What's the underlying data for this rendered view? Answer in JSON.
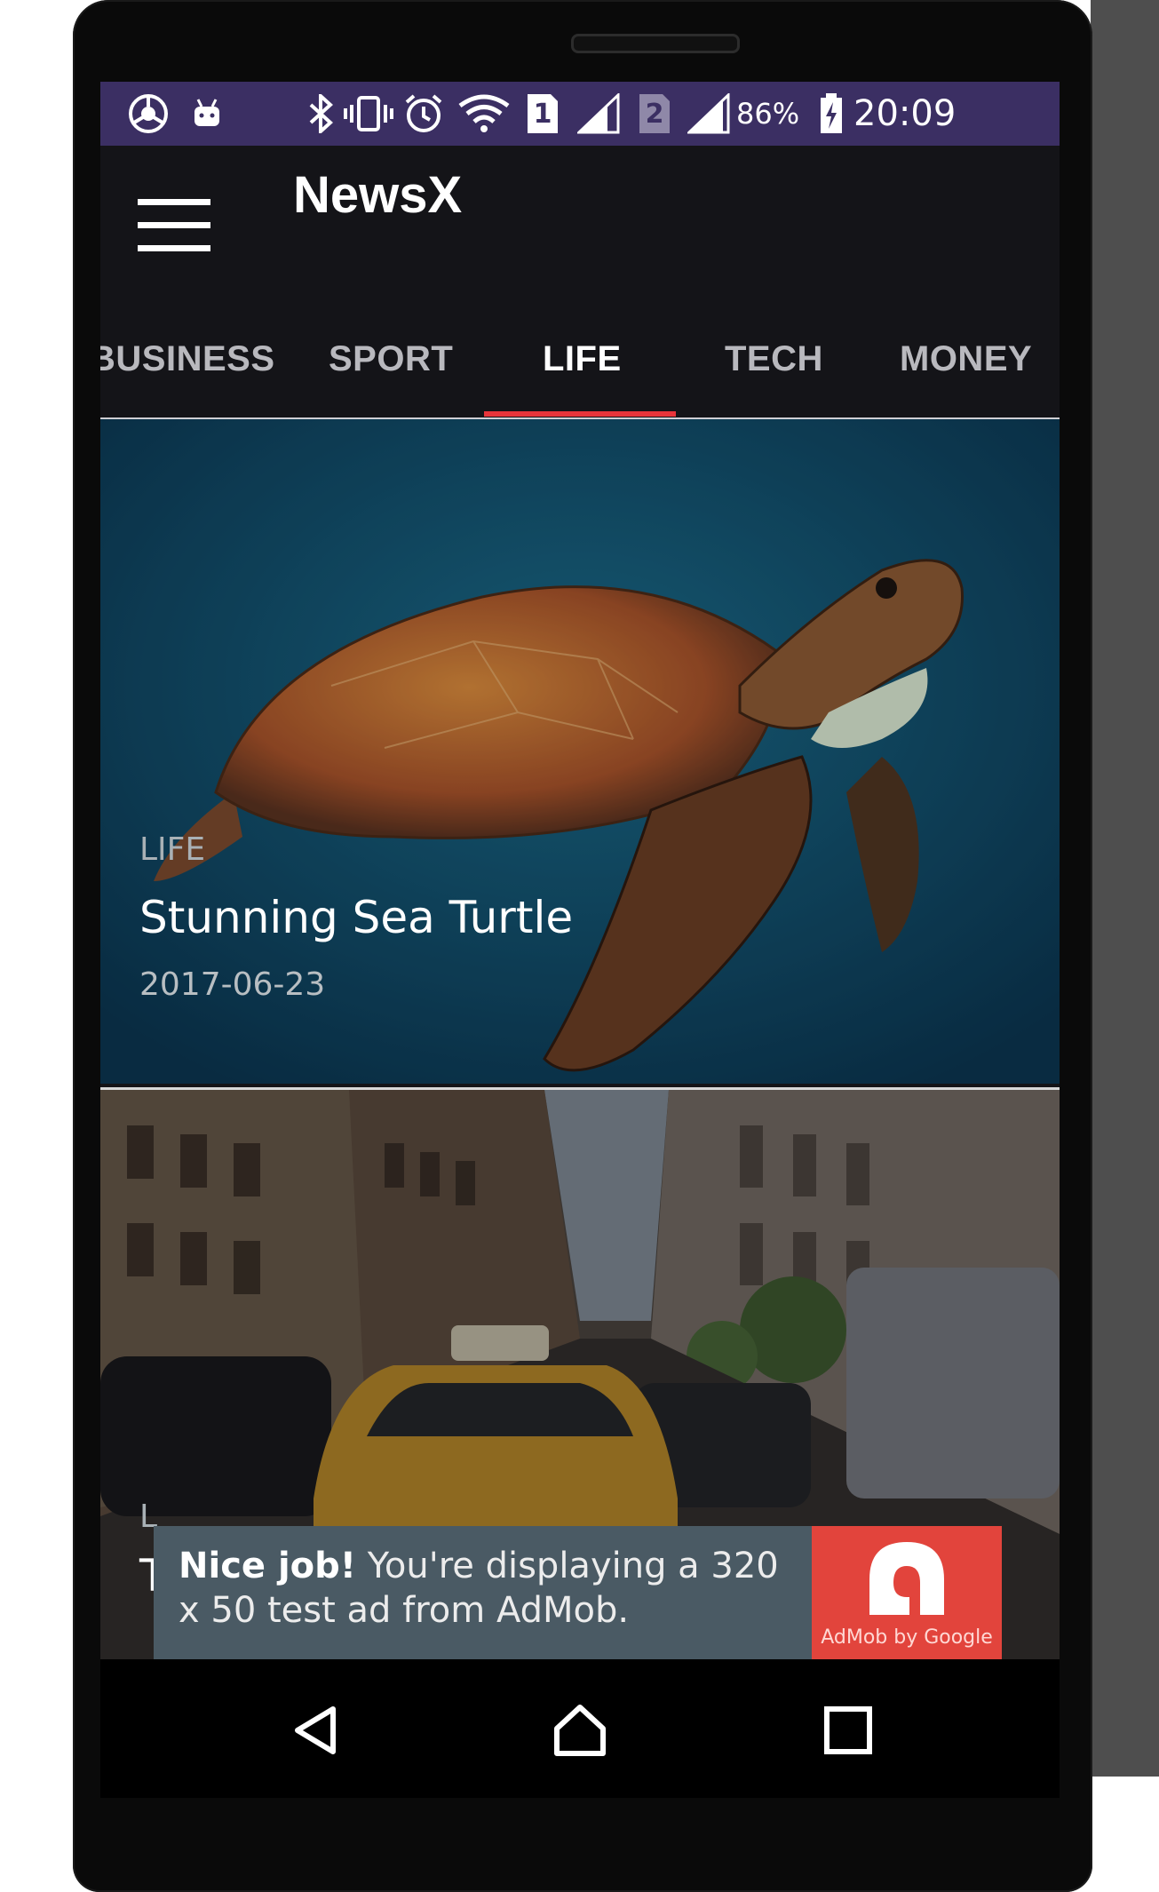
{
  "status_bar": {
    "sim1_label": "1",
    "sim2_label": "2",
    "battery_percent": "86%",
    "time": "20:09",
    "color": "#3b2f63"
  },
  "app_bar": {
    "title": "NewsX",
    "menu_icon": "hamburger-menu-icon"
  },
  "tabs": {
    "items": [
      {
        "label": "BUSINESS",
        "active": false
      },
      {
        "label": "SPORT",
        "active": false
      },
      {
        "label": "LIFE",
        "active": true
      },
      {
        "label": "TECH",
        "active": false
      },
      {
        "label": "MONEY",
        "active": false
      }
    ],
    "indicator_color": "#e8353b"
  },
  "articles": [
    {
      "category": "LIFE",
      "title": "Stunning Sea Turtle",
      "date": "2017-06-23",
      "image": "sea-turtle-photo"
    },
    {
      "category": "L",
      "title": "T",
      "image": "city-street-taxi-photo"
    }
  ],
  "ad": {
    "bold": "Nice job!",
    "text": " You're displaying a 320 x 50 test ad from AdMob.",
    "logo_label": "AdMob by Google"
  },
  "nav_bar": {
    "back": "back-icon",
    "home": "home-icon",
    "recents": "recents-icon"
  }
}
